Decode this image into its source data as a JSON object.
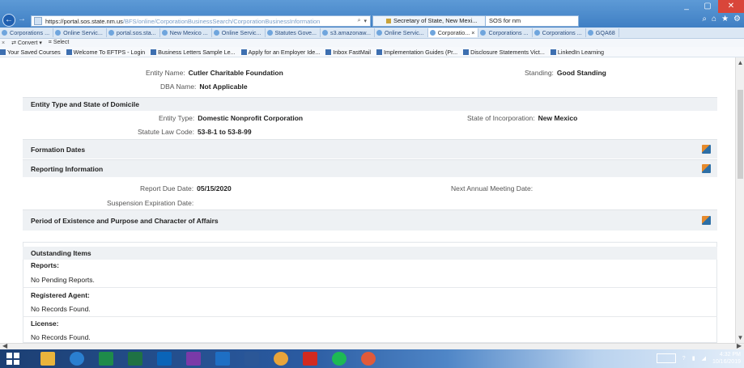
{
  "browser": {
    "url_host": "https://portal.sos.state.nm.us",
    "url_path": "/BFS/online/CorporationBusinessSearch/CorporationBusinessInformation",
    "active_tab_title": "Secretary of State, New Mexi...",
    "second_tab_title": "SOS for nm",
    "window_controls": {
      "minimize": "_",
      "maximize": "▢",
      "close": "✕"
    }
  },
  "tabstrip": [
    {
      "label": "Corporations ..."
    },
    {
      "label": "Online Servic..."
    },
    {
      "label": "portal.sos.sta..."
    },
    {
      "label": "New Mexico ..."
    },
    {
      "label": "Online Servic..."
    },
    {
      "label": "Statutes Gove..."
    },
    {
      "label": "s3.amazonaw..."
    },
    {
      "label": "Online Servic..."
    },
    {
      "label": "Corporatio... ×"
    },
    {
      "label": "Corporations ..."
    },
    {
      "label": "Corporations ..."
    },
    {
      "label": "GQA68"
    }
  ],
  "convertbar": {
    "convert": "Convert",
    "select": "Select"
  },
  "favorites": [
    "Your Saved Courses",
    "Welcome To EFTPS - Login",
    "Business Letters Sample Le...",
    "Apply for an Employer Ide...",
    "Inbox FastMail",
    "Implementation Guides (Pr...",
    "Disclosure Statements Vict...",
    "LinkedIn Learning"
  ],
  "entity": {
    "entity_name_label": "Entity Name:",
    "entity_name": "Cutler Charitable Foundation",
    "standing_label": "Standing:",
    "standing": "Good Standing",
    "dba_label": "DBA Name:",
    "dba": "Not Applicable"
  },
  "sections": {
    "type_domicile": "Entity Type and State of Domicile",
    "entity_type_label": "Entity Type:",
    "entity_type": "Domestic Nonprofit Corporation",
    "state_inc_label": "State of Incorporation:",
    "state_inc": "New Mexico",
    "statute_label": "Statute Law Code:",
    "statute": "53-8-1 to 53-8-99",
    "formation": "Formation Dates",
    "reporting": "Reporting Information",
    "report_due_label": "Report Due Date:",
    "report_due": "05/15/2020",
    "annual_meeting_label": "Next Annual Meeting Date:",
    "annual_meeting": "",
    "suspension_label": "Suspension Expiration Date:",
    "suspension": "",
    "period": "Period of Existence and Purpose and Character of Affairs"
  },
  "outstanding": {
    "title": "Outstanding Items",
    "reports_label": "Reports:",
    "reports_value": "No Pending Reports.",
    "agent_label": "Registered Agent:",
    "agent_value": "No Records Found.",
    "license_label": "License:",
    "license_value": "No Records Found."
  },
  "taskbar": {
    "time": "4:32 PM",
    "date": "10/16/2019"
  }
}
